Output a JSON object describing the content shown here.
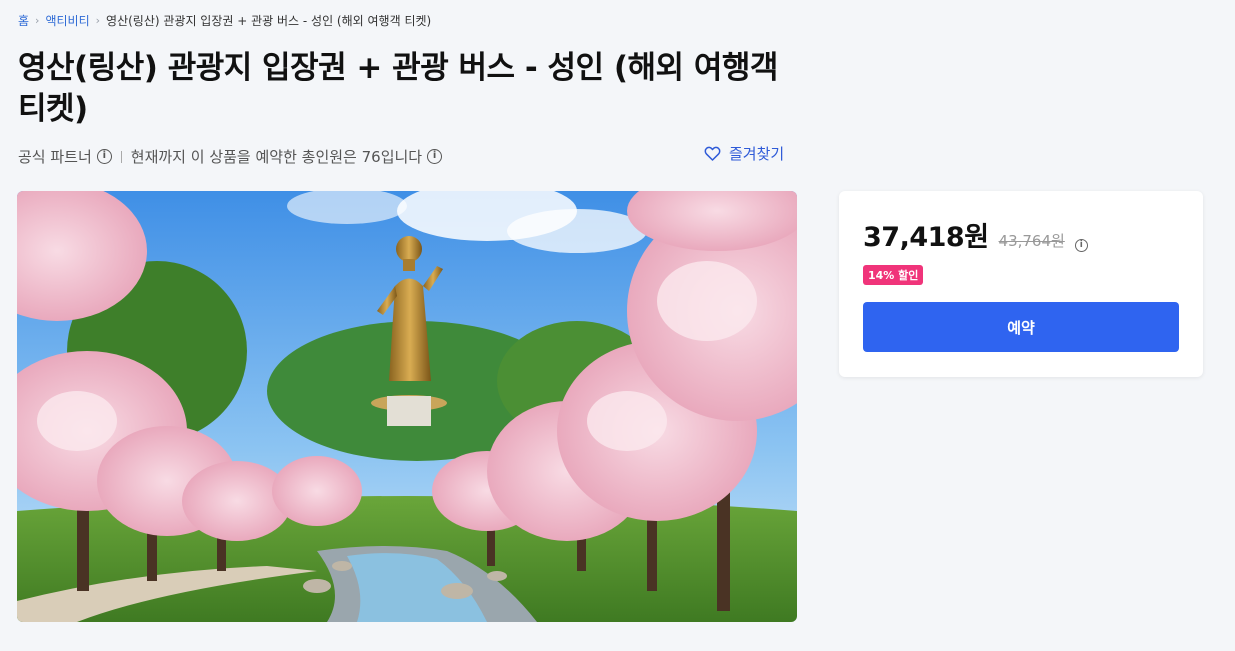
{
  "breadcrumb": {
    "home": "홈",
    "category": "액티비티",
    "current": "영산(링산) 관광지 입장권 + 관광 버스 - 성인 (해외 여행객 티켓)"
  },
  "title": "영산(링산) 관광지 입장권 + 관광 버스 - 성인 (해외 여행객 티켓)",
  "meta": {
    "partner": "공식 파트너",
    "booked_text": "현재까지 이 상품을 예약한 총인원은 76입니다",
    "favorite_label": "즐겨찾기"
  },
  "hero": {
    "description_icon": "photo"
  },
  "price_card": {
    "price": "37,418원",
    "original_price": "43,764원",
    "discount_badge": "14% 할인",
    "book_label": "예약"
  },
  "colors": {
    "accent": "#2f64f0",
    "link": "#2f6bd6",
    "badge": "#f0347a"
  }
}
